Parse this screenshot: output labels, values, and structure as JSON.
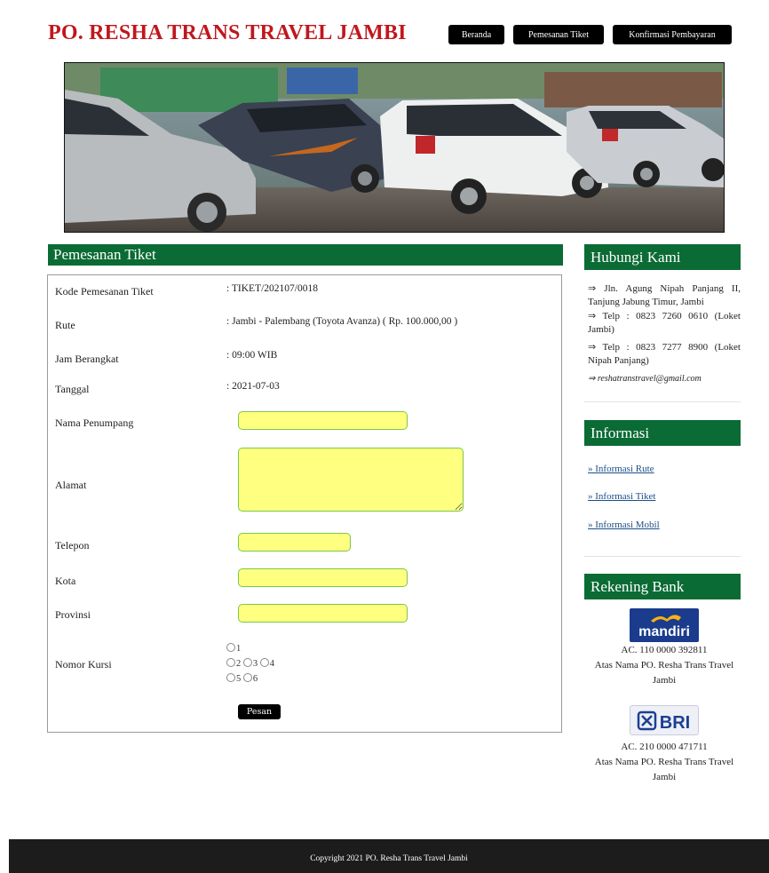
{
  "site": {
    "title": "PO. RESHA TRANS TRAVEL JAMBI"
  },
  "nav": [
    {
      "label": "Beranda"
    },
    {
      "label": "Pemesanan Tiket"
    },
    {
      "label": "Konfirmasi Pembayaran"
    }
  ],
  "main": {
    "heading": "Pemesanan Tiket",
    "fields": {
      "kode": {
        "label": "Kode Pemesanan Tiket",
        "value": ": TIKET/202107/0018"
      },
      "rute": {
        "label": "Rute",
        "value": ": Jambi - Palembang (Toyota Avanza) ( Rp. 100.000,00 )"
      },
      "jam": {
        "label": "Jam Berangkat",
        "value": ": 09:00 WIB"
      },
      "tanggal": {
        "label": "Tanggal",
        "value": ": 2021-07-03"
      },
      "nama": {
        "label": "Nama Penumpang",
        "value": ""
      },
      "alamat": {
        "label": "Alamat",
        "value": ""
      },
      "telepon": {
        "label": "Telepon",
        "value": ""
      },
      "kota": {
        "label": "Kota",
        "value": ""
      },
      "provinsi": {
        "label": "Provinsi",
        "value": ""
      },
      "kursi": {
        "label": "Nomor Kursi",
        "options": [
          "1",
          "2",
          "3",
          "4",
          "5",
          "6"
        ]
      }
    },
    "submit_label": "Pesan"
  },
  "sidebar": {
    "contact": {
      "heading": "Hubungi Kami",
      "lines": [
        "⇒ Jln. Agung Nipah Panjang II, Tanjung Jabung Timur, Jambi",
        "⇒ Telp : 0823 7260 0610 (Loket Jambi)",
        "⇒ Telp : 0823 7277 8900 (Loket Nipah Panjang)",
        "⇒ reshatranstravel@gmail.com"
      ]
    },
    "info": {
      "heading": "Informasi",
      "links": [
        "» Informasi Rute",
        "» Informasi Tiket",
        "» Informasi Mobil"
      ]
    },
    "bank": {
      "heading": "Rekening Bank",
      "accounts": [
        {
          "logo": "mandiri",
          "number": "AC. 110 0000 392811",
          "holder": "Atas Nama PO. Resha Trans Travel Jambi"
        },
        {
          "logo": "BRI",
          "number": "AC. 210 0000 471711",
          "holder": "Atas Nama PO. Resha Trans Travel Jambi"
        }
      ]
    }
  },
  "footer": {
    "text": "Copyright 2021 PO. Resha Trans Travel Jambi"
  }
}
